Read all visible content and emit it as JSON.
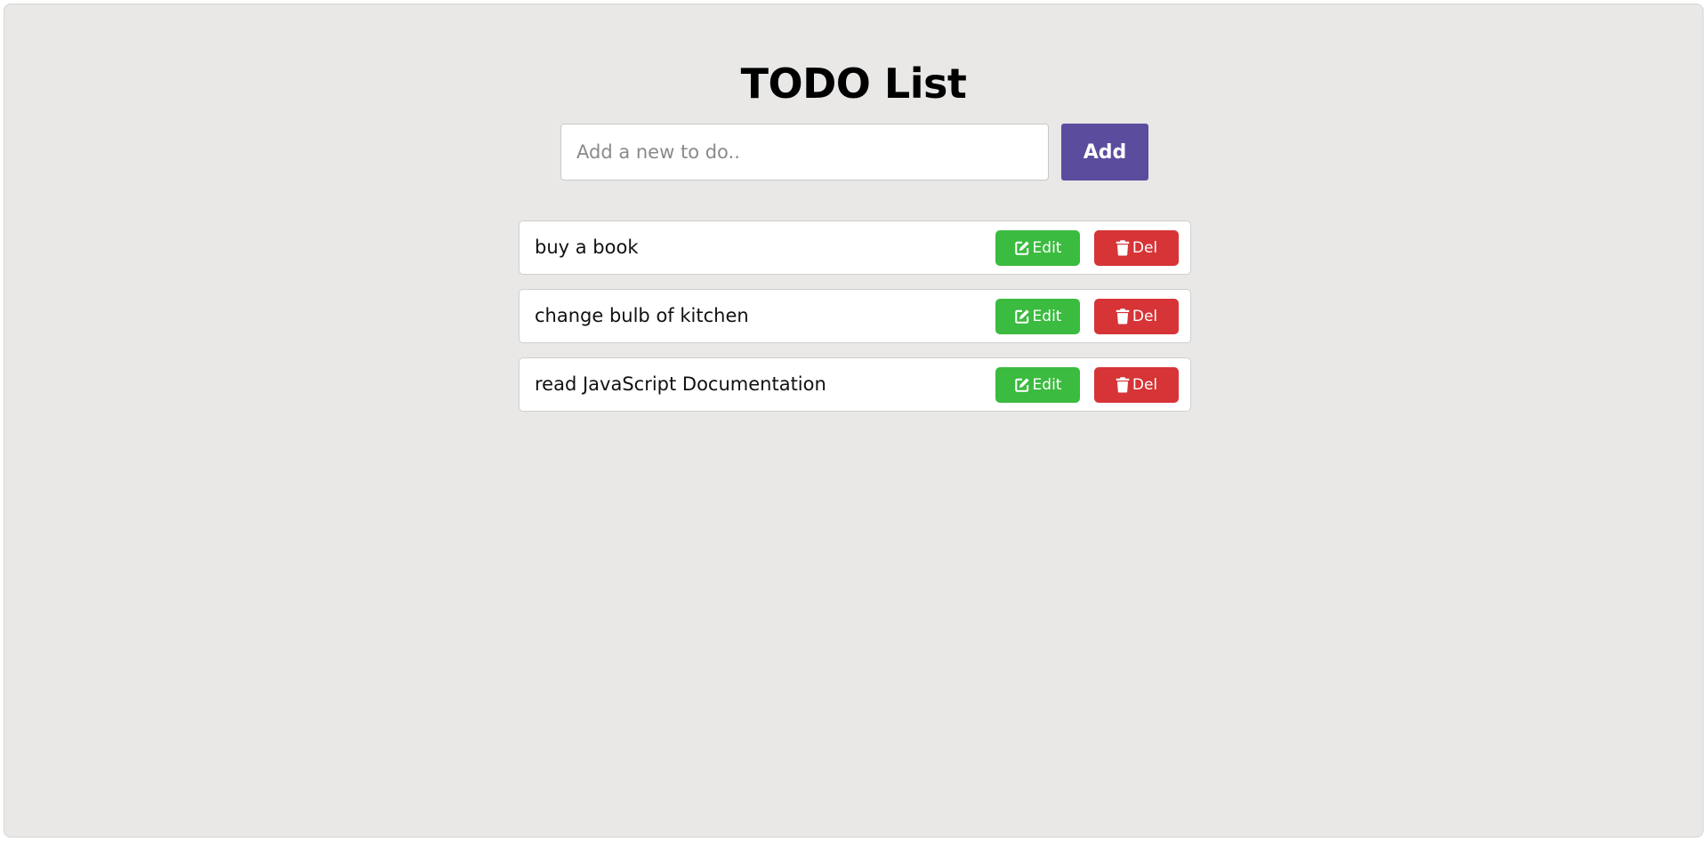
{
  "page": {
    "title": "TODO List"
  },
  "new_todo": {
    "placeholder": "Add a new to do..",
    "value": "",
    "add_label": "Add"
  },
  "todos": [
    {
      "text": "buy a book",
      "edit_label": "Edit",
      "delete_label": "Del"
    },
    {
      "text": "change bulb of kitchen",
      "edit_label": "Edit",
      "delete_label": "Del"
    },
    {
      "text": "read JavaScript Documentation",
      "edit_label": "Edit",
      "delete_label": "Del"
    }
  ],
  "icons": {
    "edit": "edit-icon",
    "delete": "trash-icon"
  },
  "colors": {
    "background": "#e9e8e6",
    "add_button": "#5c4c9e",
    "edit_button": "#3bbb3f",
    "delete_button": "#d63437"
  }
}
